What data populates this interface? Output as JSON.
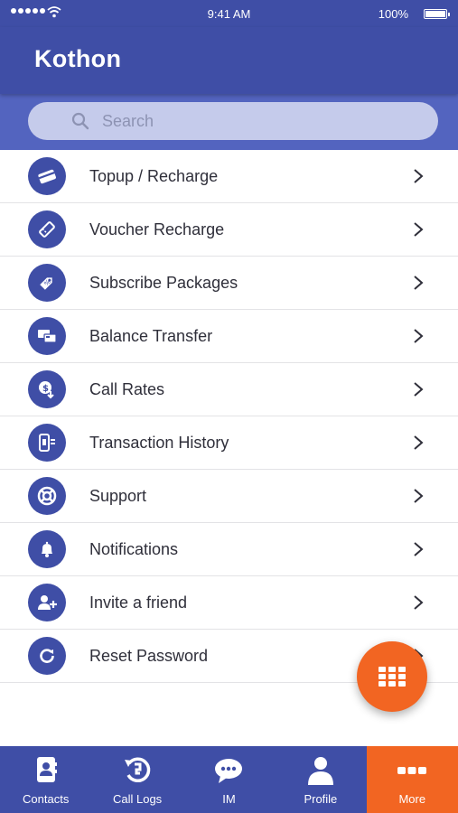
{
  "status_bar": {
    "time": "9:41 AM",
    "battery": "100%"
  },
  "header": {
    "title": "Kothon"
  },
  "search": {
    "placeholder": "Search",
    "value": ""
  },
  "menu": {
    "items": [
      {
        "label": "Topup / Recharge",
        "icon": "card-icon"
      },
      {
        "label": "Voucher Recharge",
        "icon": "voucher-icon"
      },
      {
        "label": "Subscribe Packages",
        "icon": "package-tag-icon"
      },
      {
        "label": "Balance Transfer",
        "icon": "transfer-icon"
      },
      {
        "label": "Call Rates",
        "icon": "rate-icon"
      },
      {
        "label": "Transaction History",
        "icon": "history-icon"
      },
      {
        "label": "Support",
        "icon": "support-icon"
      },
      {
        "label": "Notifications",
        "icon": "bell-icon"
      },
      {
        "label": "Invite a friend",
        "icon": "add-user-icon"
      },
      {
        "label": "Reset Password",
        "icon": "reset-icon"
      }
    ]
  },
  "tabs": [
    {
      "label": "Contacts",
      "icon": "contacts-icon"
    },
    {
      "label": "Call Logs",
      "icon": "call-logs-icon"
    },
    {
      "label": "IM",
      "icon": "chat-icon"
    },
    {
      "label": "Profile",
      "icon": "profile-icon"
    },
    {
      "label": "More",
      "icon": "more-icon",
      "active": true
    }
  ],
  "colors": {
    "primary": "#3f4ea6",
    "search_band": "#5364bf",
    "accent": "#f26522"
  }
}
